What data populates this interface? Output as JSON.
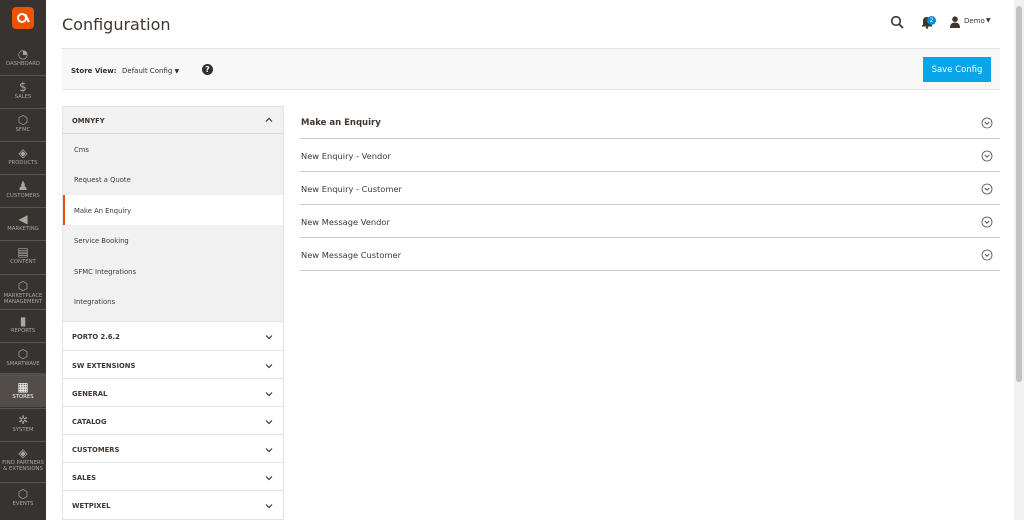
{
  "sidebar": {
    "logo_glyph": "◆",
    "items": [
      {
        "label": "DASHBOARD",
        "icon": "dashboard-icon",
        "glyph": "◔"
      },
      {
        "label": "SALES",
        "icon": "dollar-icon",
        "glyph": "$"
      },
      {
        "label": "SFMC",
        "icon": "hexagon-icon",
        "glyph": "⬡"
      },
      {
        "label": "PRODUCTS",
        "icon": "cube-icon",
        "glyph": "◈"
      },
      {
        "label": "CUSTOMERS",
        "icon": "person-icon",
        "glyph": "♟"
      },
      {
        "label": "MARKETING",
        "icon": "megaphone-icon",
        "glyph": "◀"
      },
      {
        "label": "CONTENT",
        "icon": "layout-icon",
        "glyph": "▤"
      },
      {
        "label": "MARKETPLACE MANAGEMENT",
        "icon": "hexagon-icon",
        "glyph": "⬡"
      },
      {
        "label": "REPORTS",
        "icon": "bar-chart-icon",
        "glyph": "▮"
      },
      {
        "label": "SMARTWAVE",
        "icon": "hexagon-icon",
        "glyph": "⬡"
      },
      {
        "label": "STORES",
        "icon": "store-icon",
        "glyph": "▦",
        "active": true
      },
      {
        "label": "SYSTEM",
        "icon": "gear-icon",
        "glyph": "✲"
      },
      {
        "label": "FIND PARTNERS & EXTENSIONS",
        "icon": "cube-icon",
        "glyph": "◈"
      },
      {
        "label": "EVENTS",
        "icon": "hexagon-icon",
        "glyph": "⬡"
      }
    ]
  },
  "header": {
    "title": "Configuration",
    "notifications_count": "2",
    "user_name": "Demo"
  },
  "store_view": {
    "label": "Store View:",
    "value": "Default Config",
    "help_glyph": "?",
    "save_label": "Save Config"
  },
  "config_tabs": {
    "open_group": {
      "label": "OMNYFY",
      "items": [
        "Cms",
        "Request a Quote",
        "Make An Enquiry",
        "Service Booking",
        "SFMC Integrations",
        "Integrations"
      ],
      "active_index": 2
    },
    "closed_groups": [
      "PORTO 2.6.2",
      "SW EXTENSIONS",
      "GENERAL",
      "CATALOG",
      "CUSTOMERS",
      "SALES",
      "WETPIXEL"
    ]
  },
  "sections": [
    "Make an Enquiry",
    "New Enquiry - Vendor",
    "New Enquiry - Customer",
    "New Message Vendor",
    "New Message Customer"
  ],
  "colors": {
    "sidebar_bg": "#373330",
    "accent": "#eb5202",
    "primary_button": "#0aa4e8",
    "badge": "#008bdb"
  }
}
